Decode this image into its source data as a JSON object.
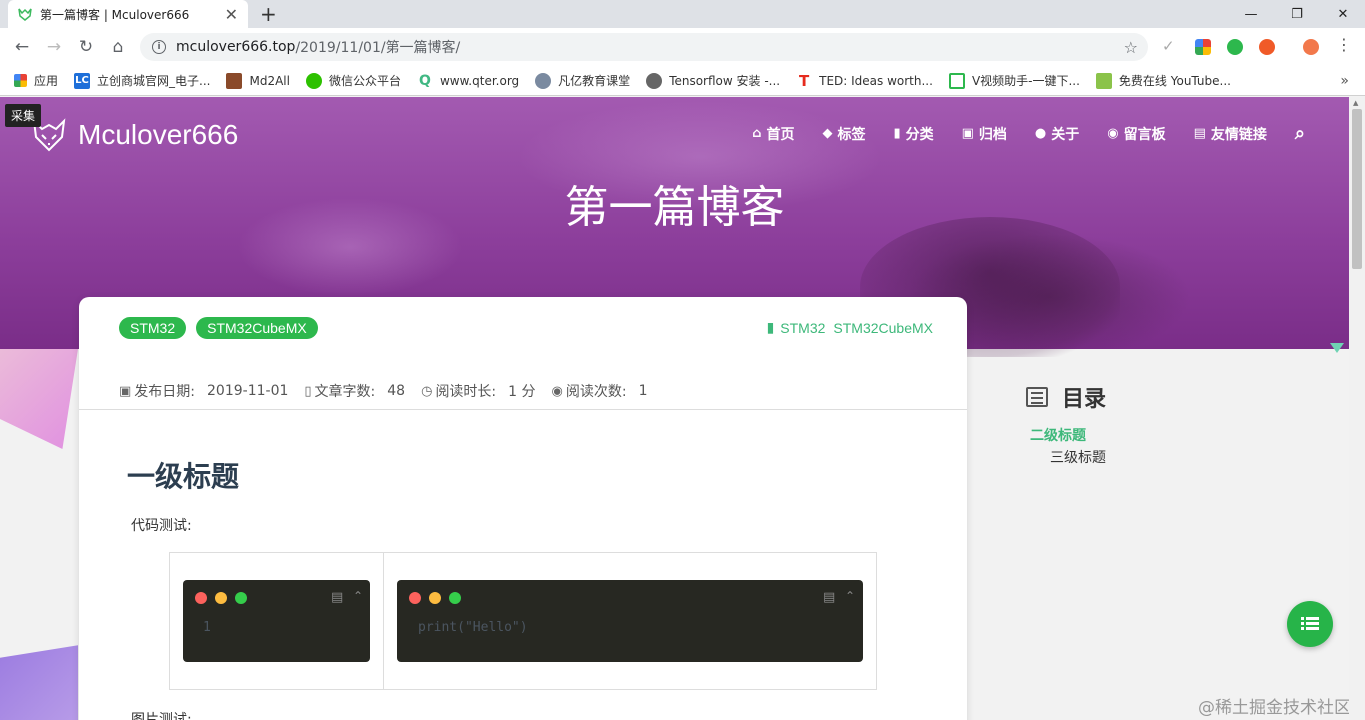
{
  "browser": {
    "tab_title": "第一篇博客 | Mculover666",
    "new_tab": "+",
    "tab_close": "✕",
    "window_controls": [
      "—",
      "❐",
      "✕"
    ],
    "url_host": "mculover666.top",
    "url_path": "/2019/11/01/第一篇博客/",
    "bookmarks": [
      {
        "label": "应用",
        "icon": "apps-grid-icon"
      },
      {
        "label": "立创商城官网_电子...",
        "icon": "lc-icon"
      },
      {
        "label": "Md2All",
        "icon": "md2all-icon"
      },
      {
        "label": "微信公众平台",
        "icon": "wechat-icon"
      },
      {
        "label": "www.qter.org",
        "icon": "qter-icon"
      },
      {
        "label": "凡亿教育课堂",
        "icon": "user-icon"
      },
      {
        "label": "Tensorflow 安装 -...",
        "icon": "globe-icon"
      },
      {
        "label": "TED: Ideas worth...",
        "icon": "ted-icon"
      },
      {
        "label": "V视频助手-一键下...",
        "icon": "video-icon"
      },
      {
        "label": "免费在线 YouTube...",
        "icon": "download-icon"
      }
    ],
    "bookmarks_more": "»"
  },
  "site": {
    "collect_label": "采集",
    "brand": "Mculover666",
    "nav": [
      {
        "label": "首页",
        "icon": "home-icon",
        "glyph": "⌂"
      },
      {
        "label": "标签",
        "icon": "tags-icon",
        "glyph": "◆"
      },
      {
        "label": "分类",
        "icon": "bookmark-icon",
        "glyph": "▮"
      },
      {
        "label": "归档",
        "icon": "archive-icon",
        "glyph": "▣"
      },
      {
        "label": "关于",
        "icon": "user-circle-icon",
        "glyph": "●"
      },
      {
        "label": "留言板",
        "icon": "comments-icon",
        "glyph": "◉"
      },
      {
        "label": "友情链接",
        "icon": "address-book-icon",
        "glyph": "▤"
      }
    ],
    "search_icon": "search-icon",
    "search_glyph": "⌕",
    "hero_title": "第一篇博客"
  },
  "post": {
    "tags": [
      "STM32",
      "STM32CubeMX"
    ],
    "categories": [
      "STM32",
      "STM32CubeMX"
    ],
    "meta": [
      {
        "label": "发布日期:",
        "value": "2019-11-01",
        "icon": "calendar-icon",
        "glyph": "▣"
      },
      {
        "label": "文章字数:",
        "value": "48",
        "icon": "file-word-icon",
        "glyph": "▯"
      },
      {
        "label": "阅读时长:",
        "value": "1 分",
        "icon": "clock-icon",
        "glyph": "◷"
      },
      {
        "label": "阅读次数:",
        "value": "1",
        "icon": "eye-icon",
        "glyph": "◉"
      }
    ],
    "heading": "一级标题",
    "p_code_test": "代码测试:",
    "code_line_number": "1",
    "code_text": "print(\"Hello\")",
    "p_image_test": "图片测试:"
  },
  "toc": {
    "title": "目录",
    "items": [
      {
        "label": "二级标题",
        "level": 2,
        "active": true
      },
      {
        "label": "三级标题",
        "level": 3,
        "active": false
      }
    ]
  },
  "watermark": "@稀土掘金技术社区",
  "colors": {
    "accent_green": "#2db84d",
    "toc_active": "#3db87a",
    "hero_purple": "#8d3f9c"
  }
}
